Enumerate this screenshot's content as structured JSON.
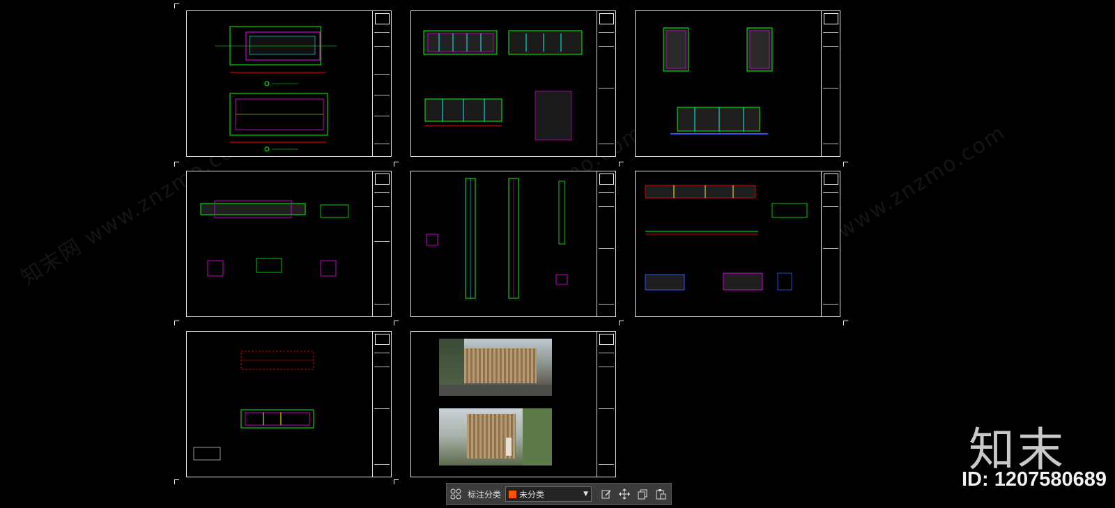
{
  "toolbar": {
    "grid_icon": "grid-icon",
    "label": "标注分类",
    "category_value": "未分类",
    "category_color": "#ff5500",
    "actions": [
      "edit-icon",
      "move-icon",
      "copy-icon",
      "paste-icon"
    ]
  },
  "brand": {
    "logo_text": "知末",
    "id_text": "ID: 1207580689"
  },
  "watermark": {
    "text": "知末网 www.znzmo.com"
  },
  "colors": {
    "green": "#00ff00",
    "magenta": "#ff00ff",
    "cyan": "#00ffff",
    "yellow": "#ffff00",
    "red": "#ff0000",
    "blue": "#3355ff",
    "white": "#ffffff"
  }
}
